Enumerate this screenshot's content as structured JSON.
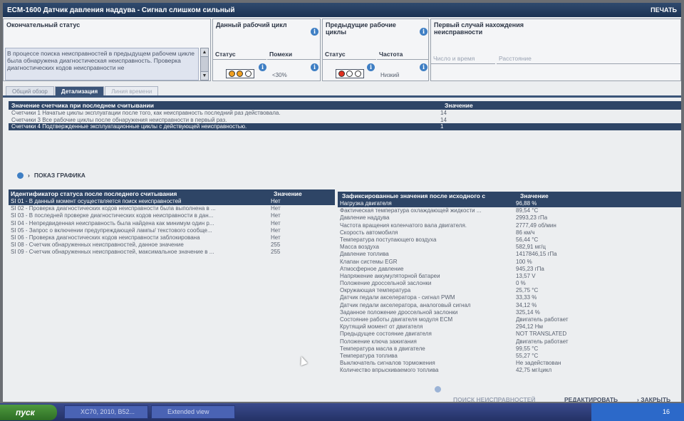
{
  "window": {
    "title": "ECM-1600 Датчик давления наддува - Сигнал слишком сильный",
    "print_label": "ПЕЧАТЬ"
  },
  "status": {
    "final_status_label": "Окончательный статус",
    "final_status_text": "В процессе поиска неисправностей в предыдущем рабочем цикле была обнаружена диагностическая неисправность. Проверка диагностических кодов неисправности не",
    "current_cycle_label": "Данный рабочий цикл",
    "previous_cycles_label": "Предыдущие рабочие циклы",
    "first_occurrence_label": "Первый случай нахождения неисправности",
    "col_status": "Статус",
    "col_interference": "Помехи",
    "col_frequency": "Частота",
    "interference_value": "<30%",
    "frequency_value": "Низкий",
    "col_datetime": "Число и время",
    "col_distance": "Расстояние",
    "lamp_current_colors": [
      "#f0a020",
      "#f0a020",
      "#ffffff"
    ],
    "lamp_previous_colors": [
      "#e03020",
      "#ffffff",
      "#ffffff"
    ]
  },
  "tabs": [
    {
      "label": "Общий обзор"
    },
    {
      "label": "Детализация"
    },
    {
      "label": "Линия времени"
    }
  ],
  "counters": {
    "header_name": "Значение счетчика при последнем считывании",
    "header_value": "Значение",
    "rows": [
      {
        "name": "Счетчики 1 Начатые циклы эксплуатации после того, как неисправность последний раз действовала.",
        "value": "14"
      },
      {
        "name": "Счетчики 3 Все рабочие циклы после обнаружения неисправности в первый раз.",
        "value": "14"
      },
      {
        "name": "Счетчики 4 Подтвержденные эксплуатационные циклы с действующей неисправностью.",
        "value": "1"
      }
    ]
  },
  "graph_link": "ПОКАЗ ГРАФИКА",
  "status_ids": {
    "header_name": "Идентификатор статуса после последнего считывания",
    "header_value": "Значение",
    "rows": [
      {
        "name": "SI 01 - В данный момент осуществляется поиск неисправностей",
        "value": "Нет"
      },
      {
        "name": "SI 02 - Проверка диагностических кодов неисправности была выполнена в ...",
        "value": "Нет"
      },
      {
        "name": "SI 03 - В последней проверке диагностических кодов неисправности в дан...",
        "value": "Нет"
      },
      {
        "name": "SI 04 - Непредвиденная неисправность была найдена как минимум один р...",
        "value": "Нет"
      },
      {
        "name": "SI 05 - Запрос о включении предупреждающей лампы/ текстового сообще...",
        "value": "Нет"
      },
      {
        "name": "SI 06 - Проверка диагностических кодов неисправности заблокирована",
        "value": "Нет"
      },
      {
        "name": "SI 08 - Счетчик обнаруженных неисправностей, данное значение",
        "value": "255"
      },
      {
        "name": "SI 09 - Счетчик обнаруженных неисправностей, максимальное значение в ...",
        "value": "255"
      }
    ]
  },
  "frozen": {
    "header_name": "Зафиксированные значения после исходного с",
    "header_value": "Значение",
    "rows": [
      {
        "name": "Нагрузка двигателя",
        "value": "96,88 %"
      },
      {
        "name": "Фактическая температура охлаждающей жидкости ...",
        "value": "89,54 °C"
      },
      {
        "name": "Давление наддува",
        "value": "2993,23 гПа"
      },
      {
        "name": "Частота вращения коленчатого вала двигателя.",
        "value": "2777,49 об/мин"
      },
      {
        "name": "Скорость автомобиля",
        "value": "86 км/ч"
      },
      {
        "name": "Температура поступающего воздуха",
        "value": "56,44 °C"
      },
      {
        "name": "Масса воздуха",
        "value": "582,91 мг/ц"
      },
      {
        "name": "Давление топлива",
        "value": "1417846,15 гПа"
      },
      {
        "name": "Клапан системы EGR",
        "value": "100 %"
      },
      {
        "name": "Атмосферное давление",
        "value": "945,23 гПа"
      },
      {
        "name": "Напряжение аккумуляторной батареи",
        "value": "13,57 V"
      },
      {
        "name": "Положение дроссельной заслонки",
        "value": "0 %"
      },
      {
        "name": "Окружающая температура",
        "value": "25,75 °C"
      },
      {
        "name": "Датчик педали акселератора - сигнал PWM",
        "value": "33,33 %"
      },
      {
        "name": "Датчик педали акселератора, аналоговый сигнал",
        "value": "34,12 %"
      },
      {
        "name": "Заданное положение дроссельной заслонки",
        "value": "325,14 %"
      },
      {
        "name": "Состояние работы двигателя модуля ECM",
        "value": "Двигатель работает"
      },
      {
        "name": "Крутящий момент от двигателя",
        "value": "294,12 Нм"
      },
      {
        "name": "Предыдущее состояние двигателя",
        "value": "NOT TRANSLATED"
      },
      {
        "name": "Положение ключа зажигания",
        "value": "Двигатель работает"
      },
      {
        "name": "Температура масла в двигателе",
        "value": "99,55 °C"
      },
      {
        "name": "Температура топлива",
        "value": "55,27 °C"
      },
      {
        "name": "Выключатель сигналов торможения",
        "value": "Не задействован"
      },
      {
        "name": "Количество впрыскиваемого топлива",
        "value": "42,75 мг/цикл"
      }
    ]
  },
  "footer": {
    "find_fault": "ПОИСК НЕИСПРАВНОСТЕЙ",
    "edit": "РЕДАКТИРОВАТЬ",
    "close": "ЗАКРЫТЬ"
  },
  "taskbar": {
    "start": "пуск",
    "tasks": [
      {
        "label": "XC70, 2010, B52..."
      },
      {
        "label": "Extended view"
      }
    ],
    "clock": "16"
  }
}
